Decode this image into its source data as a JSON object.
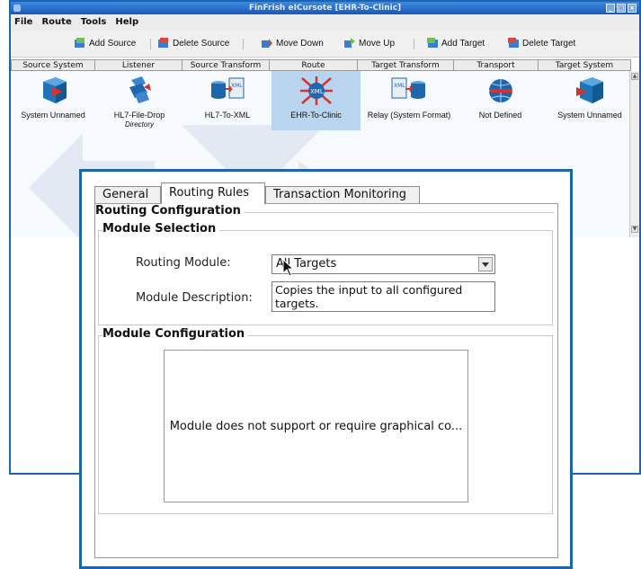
{
  "window": {
    "title": "FinFrish eICursote [EHR-To-Clinic]",
    "controls": [
      "_",
      "□",
      "×"
    ]
  },
  "menu": [
    "File",
    "Route",
    "Tools",
    "Help"
  ],
  "toolbar": {
    "add_source": "Add Source",
    "delete_source": "Delete Source",
    "move_down": "Move Down",
    "move_up": "Move Up",
    "add_target": "Add Target",
    "delete_target": "Delete Target"
  },
  "columns": [
    "Source System",
    "Listener",
    "Source Transform",
    "Route",
    "Target Transform",
    "Transport",
    "Target System"
  ],
  "stages": [
    {
      "label": "System Unnamed",
      "icon": "system-cube-icon"
    },
    {
      "label": "HL7-File-Drop",
      "sublabel": "Directory",
      "icon": "file-drop-listener-icon"
    },
    {
      "label": "HL7-To-XML",
      "icon": "xml-transform-icon"
    },
    {
      "label": "EHR-To-Clinic",
      "icon": "xml-route-icon",
      "selected": true
    },
    {
      "label": "Relay (System Format)",
      "icon": "xml-relay-icon"
    },
    {
      "label": "Not Defined",
      "icon": "globe-transport-icon"
    },
    {
      "label": "System Unnamed",
      "icon": "system-cube-icon"
    }
  ],
  "dialog": {
    "tabs": [
      "General",
      "Routing Rules",
      "Transaction Monitoring"
    ],
    "active_tab": "Routing Rules",
    "routing_configuration": "Routing Configuration",
    "module_selection": "Module Selection",
    "routing_module_label": "Routing Module:",
    "routing_module_value": "All Targets",
    "module_description_label": "Module Description:",
    "module_description_value": "Copies the input to all configured targets.",
    "module_configuration": "Module Configuration",
    "config_placeholder": "Module does not support or require graphical co..."
  },
  "colors": {
    "window_border": "#1c64b0",
    "selected_stage": "#b9d4ef"
  }
}
